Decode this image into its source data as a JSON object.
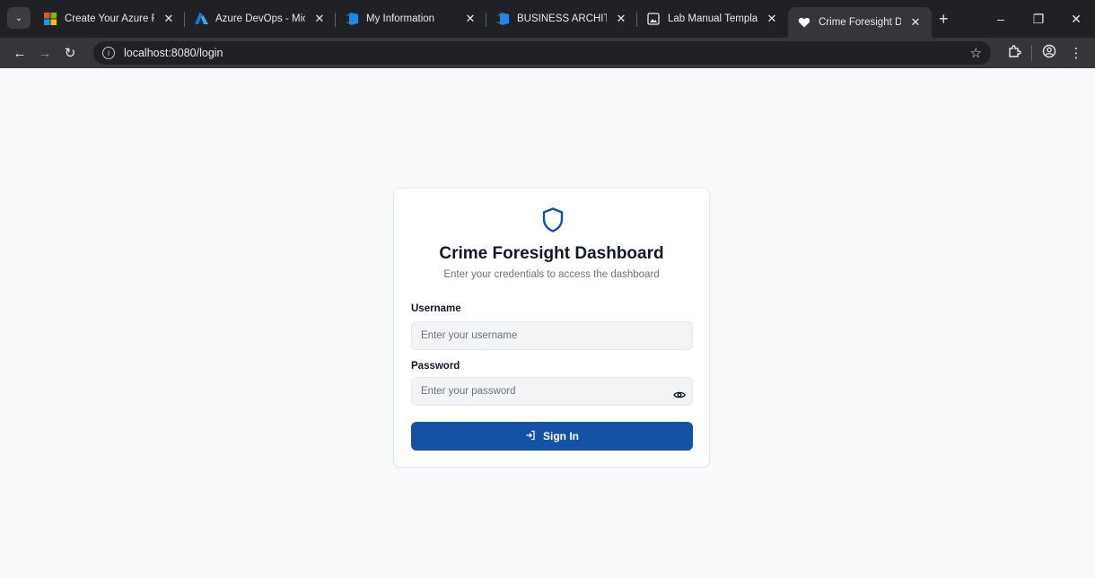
{
  "browser": {
    "tabs": [
      {
        "title": "Create Your Azure Free Ac",
        "icon": "microsoft-logo-icon"
      },
      {
        "title": "Azure DevOps - Microsoft",
        "icon": "azure-logo-icon"
      },
      {
        "title": "My Information",
        "icon": "azure-devops-icon"
      },
      {
        "title": "BUSINESS ARCHITECTURE",
        "icon": "azure-devops-icon"
      },
      {
        "title": "Lab Manual Template",
        "icon": "image-icon"
      },
      {
        "title": "Crime Foresight Dashboar",
        "icon": "heart-icon",
        "active": true
      }
    ],
    "address_bar": {
      "url": "localhost:8080/login"
    }
  },
  "login": {
    "title": "Crime Foresight Dashboard",
    "subtitle": "Enter your credentials to access the dashboard",
    "username": {
      "label": "Username",
      "placeholder": "Enter your username",
      "value": ""
    },
    "password": {
      "label": "Password",
      "placeholder": "Enter your password",
      "value": ""
    },
    "submit_label": "Sign In",
    "accent_color": "#1453a3"
  }
}
